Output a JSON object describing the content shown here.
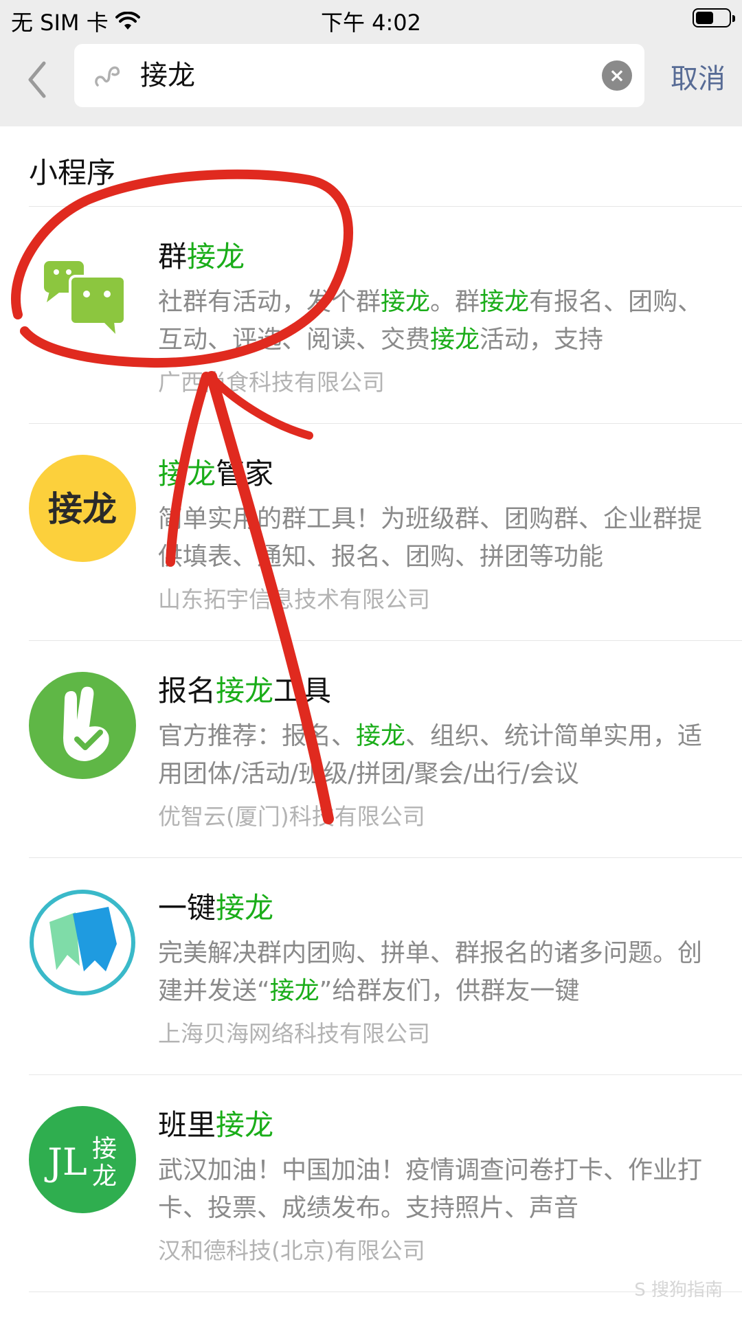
{
  "status_bar": {
    "carrier": "无 SIM 卡",
    "time": "下午 4:02",
    "battery_level": 0.55
  },
  "search": {
    "value": "接龙",
    "cancel_label": "取消"
  },
  "section_title": "小程序",
  "results": [
    {
      "title_parts": [
        {
          "text": "群",
          "hl": false
        },
        {
          "text": "接龙",
          "hl": true
        }
      ],
      "desc_parts": [
        {
          "text": "社群有活动，发个群",
          "hl": false
        },
        {
          "text": "接龙",
          "hl": true
        },
        {
          "text": "。群",
          "hl": false
        },
        {
          "text": "接龙",
          "hl": true
        },
        {
          "text": "有报名、团购、互动、评选、阅读、交费",
          "hl": false
        },
        {
          "text": "接龙",
          "hl": true
        },
        {
          "text": "活动，支持",
          "hl": false
        }
      ],
      "company": "广西尚食科技有限公司",
      "icon": "chat-bubbles-icon"
    },
    {
      "title_parts": [
        {
          "text": "接龙",
          "hl": true
        },
        {
          "text": "管家",
          "hl": false
        }
      ],
      "desc_parts": [
        {
          "text": "简单实用的群工具！为班级群、团购群、企业群提供填表、通知、报名、团购、拼团等功能",
          "hl": false
        }
      ],
      "company": "山东拓宇信息技术有限公司",
      "icon": "jielong-logo-icon",
      "icon_text": "接龙"
    },
    {
      "title_parts": [
        {
          "text": "报名",
          "hl": false
        },
        {
          "text": "接龙",
          "hl": true
        },
        {
          "text": "工具",
          "hl": false
        }
      ],
      "desc_parts": [
        {
          "text": "官方推荐：报名、",
          "hl": false
        },
        {
          "text": "接龙",
          "hl": true
        },
        {
          "text": "、组织、统计简单实用，适用团体/活动/班级/拼团/聚会/出行/会议",
          "hl": false
        }
      ],
      "company": "优智云(厦门)科技有限公司",
      "icon": "hand-check-icon"
    },
    {
      "title_parts": [
        {
          "text": "一键",
          "hl": false
        },
        {
          "text": "接龙",
          "hl": true
        }
      ],
      "desc_parts": [
        {
          "text": "完美解决群内团购、拼单、群报名的诸多问题。创建并发送“",
          "hl": false
        },
        {
          "text": "接龙",
          "hl": true
        },
        {
          "text": "”给群友们，供群友一键",
          "hl": false
        }
      ],
      "company": "上海贝海网络科技有限公司",
      "icon": "bookmark-ribbons-icon"
    },
    {
      "title_parts": [
        {
          "text": "班里",
          "hl": false
        },
        {
          "text": "接龙",
          "hl": true
        }
      ],
      "desc_parts": [
        {
          "text": "武汉加油！中国加油！疫情调查问卷打卡、作业打卡、投票、成绩发布。支持照片、声音",
          "hl": false
        }
      ],
      "company": "汉和德科技(北京)有限公司",
      "icon": "jl-logo-icon",
      "icon_text_jl": "JL",
      "icon_text_cn": "接龙"
    }
  ],
  "watermark": "S 搜狗指南",
  "colors": {
    "highlight": "#1aad19",
    "link": "#576b95",
    "annotation": "#e02a1f"
  }
}
